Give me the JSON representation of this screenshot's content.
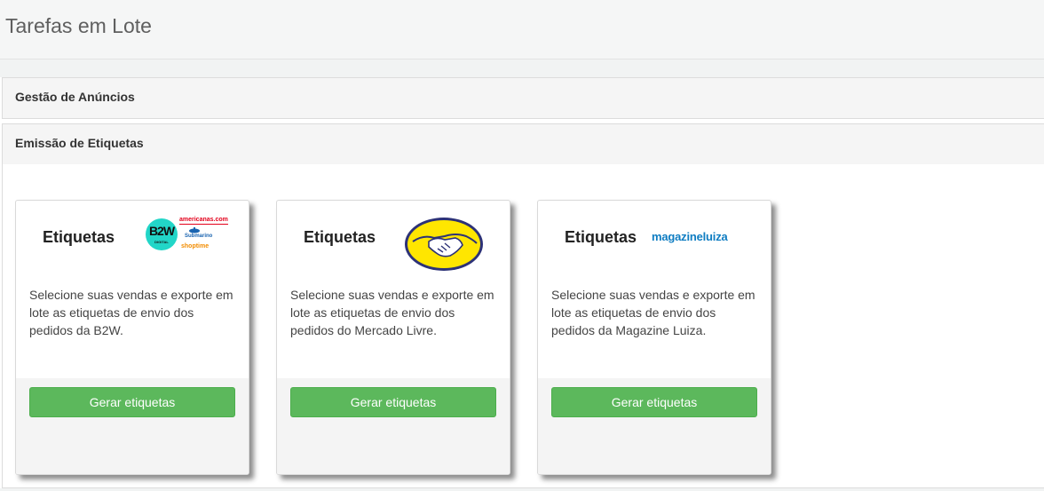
{
  "header": {
    "title": "Tarefas em Lote"
  },
  "panels": {
    "ads": {
      "title": "Gestão de Anúncios"
    },
    "labels": {
      "title": "Emissão de Etiquetas"
    }
  },
  "cards": [
    {
      "title": "Etiquetas",
      "logo": {
        "icon": "b2w-logo",
        "brand_text": "B2W",
        "sub_text": "DIGITAL",
        "americanas": "americanas.com",
        "submarino": "Submarino",
        "shoptime": "shoptime"
      },
      "description": "Selecione suas vendas e exporte em lote as etiquetas de envio dos pedidos da B2W.",
      "button_label": "Gerar etiquetas"
    },
    {
      "title": "Etiquetas",
      "logo": {
        "icon": "mercado-livre-handshake-logo"
      },
      "description": "Selecione suas vendas e exporte em lote as etiquetas de envio dos pedidos do Mercado Livre.",
      "button_label": "Gerar etiquetas"
    },
    {
      "title": "Etiquetas",
      "logo": {
        "icon": "magazine-luiza-logo",
        "text": "magazineluiza"
      },
      "description": "Selecione suas vendas e exporte em lote as etiquetas de envio dos pedidos da Magazine Luiza.",
      "button_label": "Gerar etiquetas"
    }
  ],
  "colors": {
    "button_green": "#5cb85c",
    "magalu_blue": "#0f7dc2",
    "ml_yellow": "#ffe600",
    "ml_blue": "#2d3277",
    "b2w_teal": "#22d6c8"
  }
}
